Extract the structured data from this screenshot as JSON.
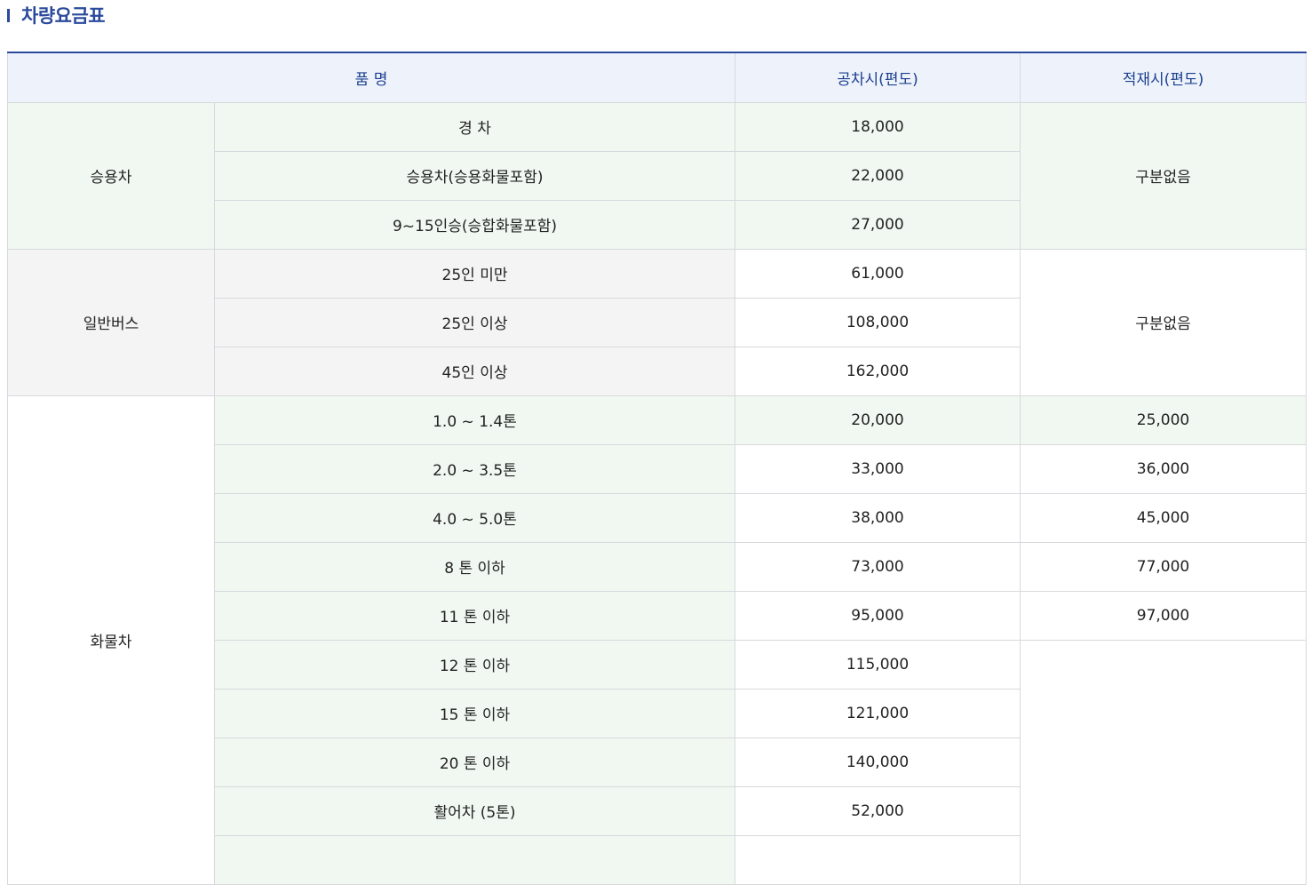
{
  "page": {
    "title": "차량요금표"
  },
  "table": {
    "headers": {
      "item": "품 명",
      "empty_fare": "공차시(편도)",
      "loaded_fare": "적재시(편도)"
    },
    "groups": {
      "passenger": {
        "name": "승용차",
        "loaded_fare": "구분없음",
        "rows": [
          {
            "item": "경 차",
            "empty_fare": "18,000"
          },
          {
            "item": "승용차(승용화물포함)",
            "empty_fare": "22,000"
          },
          {
            "item": "9~15인승(승합화물포함)",
            "empty_fare": "27,000"
          }
        ]
      },
      "bus": {
        "name": "일반버스",
        "loaded_fare": "구분없음",
        "rows": [
          {
            "item": "25인 미만",
            "empty_fare": "61,000"
          },
          {
            "item": "25인 이상",
            "empty_fare": "108,000"
          },
          {
            "item": "45인 이상",
            "empty_fare": "162,000"
          }
        ]
      },
      "truck": {
        "name": "화물차",
        "rows": [
          {
            "item": "1.0 ~ 1.4톤",
            "empty_fare": "20,000",
            "loaded_fare": "25,000"
          },
          {
            "item": "2.0 ~ 3.5톤",
            "empty_fare": "33,000",
            "loaded_fare": "36,000"
          },
          {
            "item": "4.0 ~ 5.0톤",
            "empty_fare": "38,000",
            "loaded_fare": "45,000"
          },
          {
            "item": "8 톤 이하",
            "empty_fare": "73,000",
            "loaded_fare": "77,000"
          },
          {
            "item": "11 톤 이하",
            "empty_fare": "95,000",
            "loaded_fare": "97,000"
          },
          {
            "item": "12 톤 이하",
            "empty_fare": "115,000"
          },
          {
            "item": "15 톤 이하",
            "empty_fare": "121,000"
          },
          {
            "item": "20 톤 이하",
            "empty_fare": "140,000"
          },
          {
            "item": "활어차 (5톤)",
            "empty_fare": "52,000"
          }
        ]
      }
    }
  }
}
